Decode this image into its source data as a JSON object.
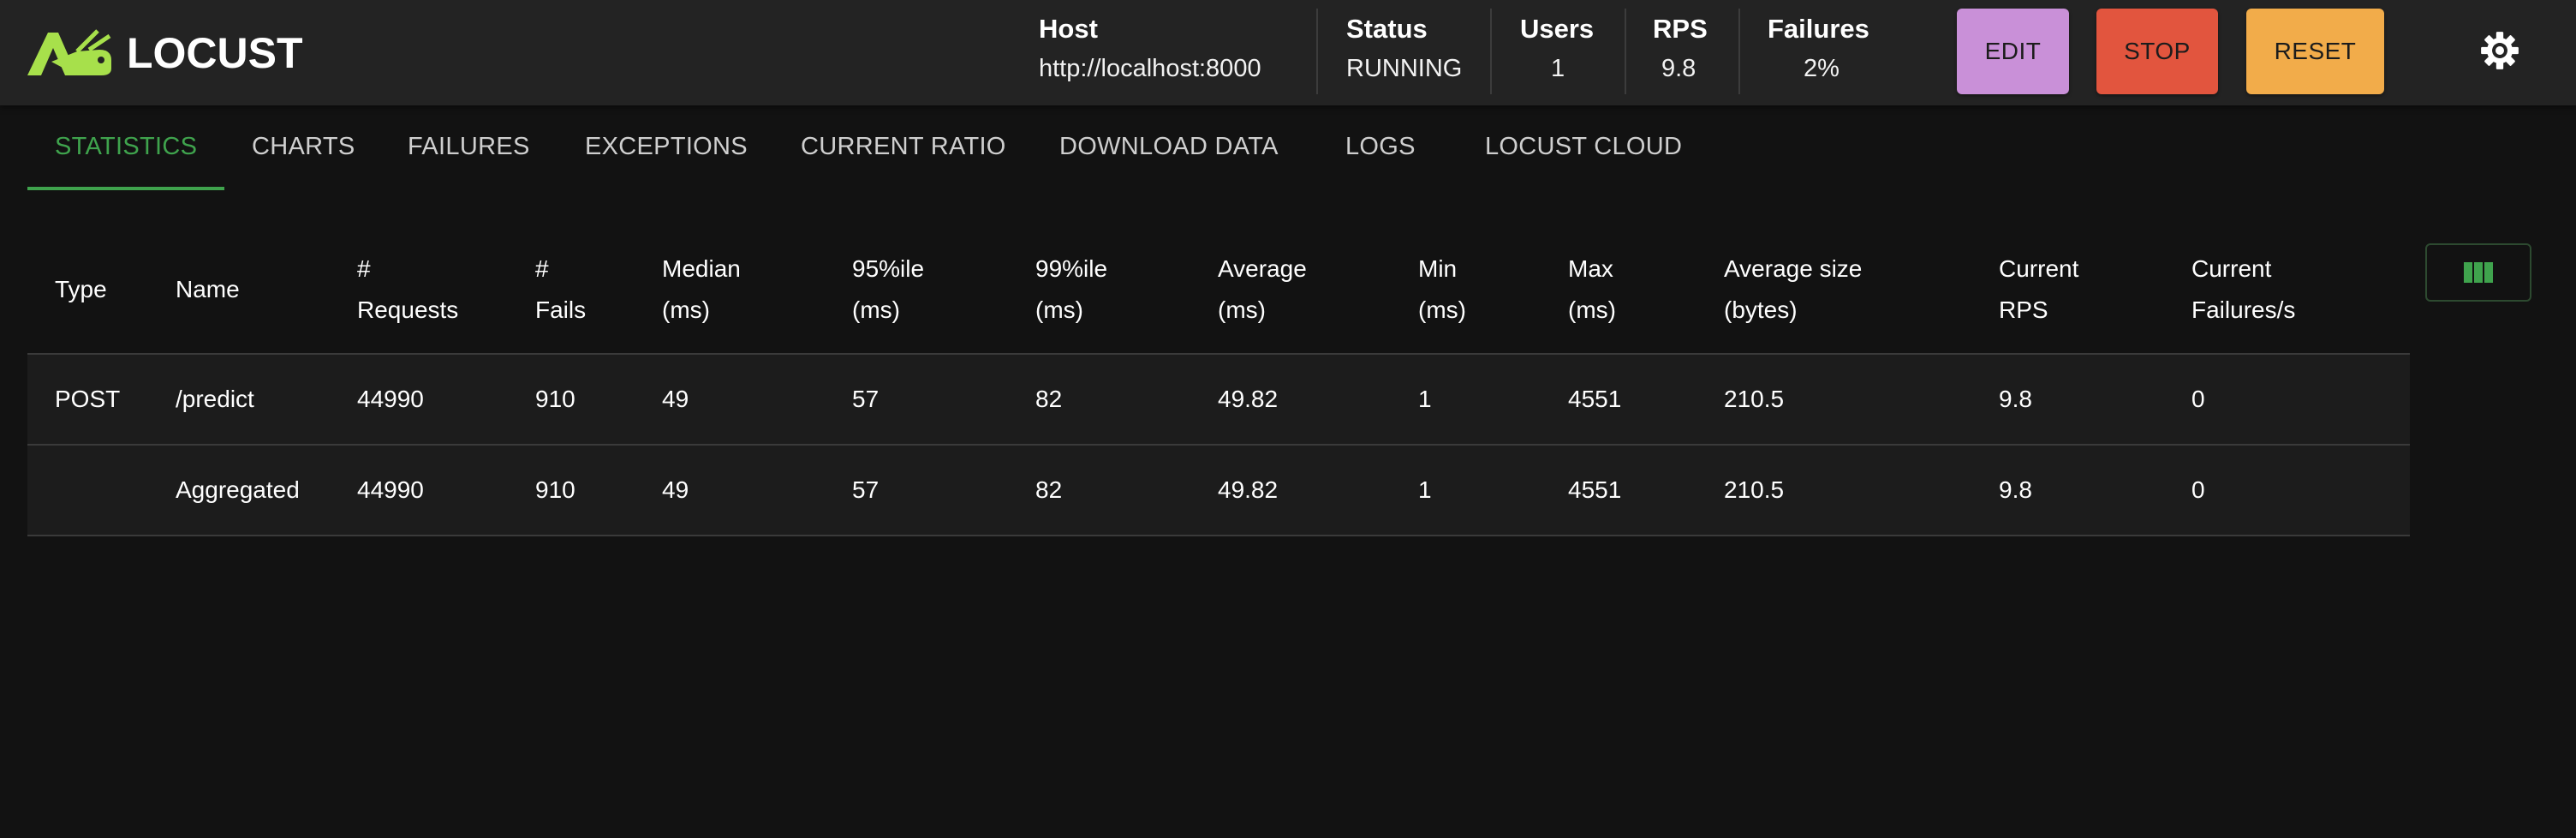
{
  "app": {
    "name": "LOCUST",
    "brand_color": "#a7e04b"
  },
  "header": {
    "stats": [
      {
        "label": "Host",
        "value": "http://localhost:8000"
      },
      {
        "label": "Status",
        "value": "RUNNING"
      },
      {
        "label": "Users",
        "value": "1"
      },
      {
        "label": "RPS",
        "value": "9.8"
      },
      {
        "label": "Failures",
        "value": "2%"
      }
    ],
    "buttons": {
      "edit": {
        "label": "EDIT",
        "color": "#c990d8"
      },
      "stop": {
        "label": "STOP",
        "color": "#e2553e"
      },
      "reset": {
        "label": "RESET",
        "color": "#f2ac4a"
      }
    },
    "settings_icon": "gear-icon"
  },
  "tabs": [
    {
      "label": "STATISTICS",
      "active": true
    },
    {
      "label": "CHARTS"
    },
    {
      "label": "FAILURES"
    },
    {
      "label": "EXCEPTIONS"
    },
    {
      "label": "CURRENT RATIO"
    },
    {
      "label": "DOWNLOAD DATA"
    },
    {
      "label": "LOGS"
    },
    {
      "label": "LOCUST CLOUD"
    }
  ],
  "table": {
    "columns": [
      {
        "l1": "Type",
        "l2": ""
      },
      {
        "l1": "Name",
        "l2": ""
      },
      {
        "l1": "#",
        "l2": "Requests"
      },
      {
        "l1": "#",
        "l2": "Fails"
      },
      {
        "l1": "Median",
        "l2": "(ms)"
      },
      {
        "l1": "95%ile",
        "l2": "(ms)"
      },
      {
        "l1": "99%ile",
        "l2": "(ms)"
      },
      {
        "l1": "Average",
        "l2": "(ms)"
      },
      {
        "l1": "Min",
        "l2": "(ms)"
      },
      {
        "l1": "Max",
        "l2": "(ms)"
      },
      {
        "l1": "Average size",
        "l2": "(bytes)"
      },
      {
        "l1": "Current",
        "l2": "RPS"
      },
      {
        "l1": "Current",
        "l2": "Failures/s"
      }
    ],
    "rows": [
      [
        "POST",
        "/predict",
        "44990",
        "910",
        "49",
        "57",
        "82",
        "49.82",
        "1",
        "4551",
        "210.5",
        "9.8",
        "0"
      ],
      [
        "",
        "Aggregated",
        "44990",
        "910",
        "49",
        "57",
        "82",
        "49.82",
        "1",
        "4551",
        "210.5",
        "9.8",
        "0"
      ]
    ],
    "columns_button_icon": "columns-icon",
    "accent_color": "#3fa34d"
  }
}
